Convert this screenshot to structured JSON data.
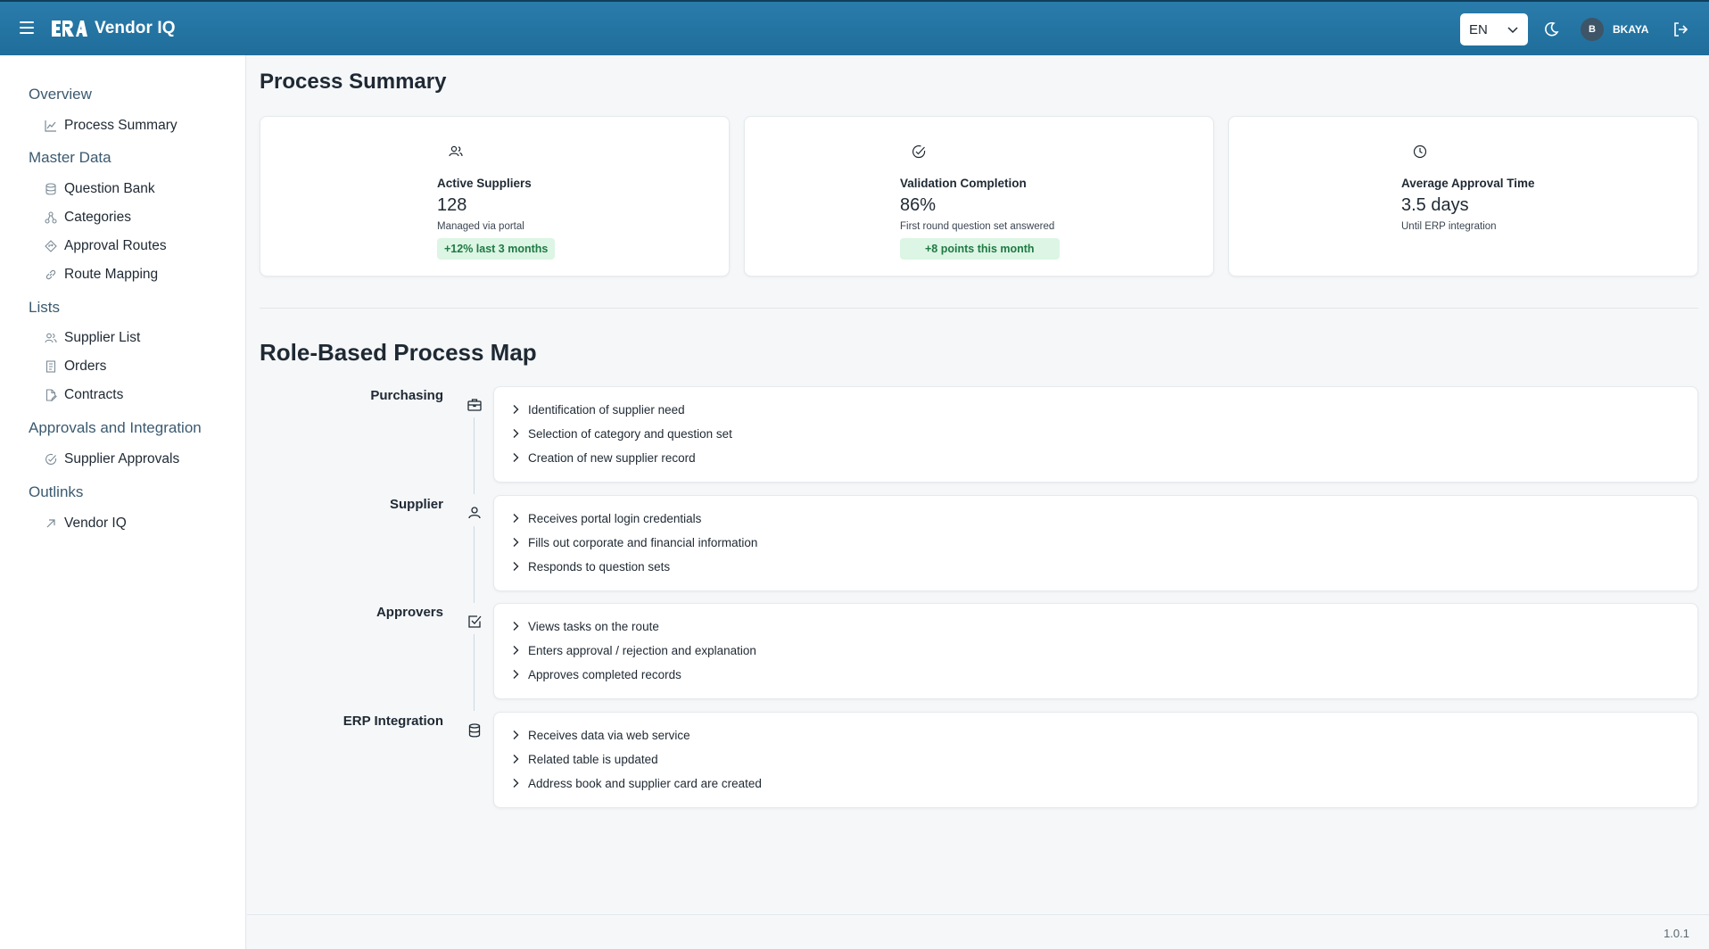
{
  "header": {
    "app_title": "Vendor IQ",
    "language": "EN",
    "user_initial": "B",
    "username": "BKAYA"
  },
  "sidebar": {
    "sections": [
      {
        "title": "Overview",
        "items": [
          {
            "label": "Process Summary",
            "icon": "chart-line-icon"
          }
        ]
      },
      {
        "title": "Master Data",
        "items": [
          {
            "label": "Question Bank",
            "icon": "database-icon"
          },
          {
            "label": "Categories",
            "icon": "hierarchy-icon"
          },
          {
            "label": "Approval Routes",
            "icon": "route-diamond-icon"
          },
          {
            "label": "Route Mapping",
            "icon": "link-icon"
          }
        ]
      },
      {
        "title": "Lists",
        "items": [
          {
            "label": "Supplier List",
            "icon": "users-icon"
          },
          {
            "label": "Orders",
            "icon": "receipt-icon"
          },
          {
            "label": "Contracts",
            "icon": "document-edit-icon"
          }
        ]
      },
      {
        "title": "Approvals and Integration",
        "items": [
          {
            "label": "Supplier Approvals",
            "icon": "check-circle-icon"
          }
        ]
      },
      {
        "title": "Outlinks",
        "items": [
          {
            "label": "Vendor IQ",
            "icon": "arrow-up-right-icon"
          }
        ]
      }
    ]
  },
  "main": {
    "page_title": "Process Summary",
    "stats": [
      {
        "icon": "users-icon",
        "label": "Active Suppliers",
        "value": "128",
        "sub": "Managed via portal",
        "badge": "+12% last 3 months"
      },
      {
        "icon": "check-circle-icon",
        "label": "Validation Completion",
        "value": "86%",
        "sub": "First round question set answered",
        "badge": "+8 points this month"
      },
      {
        "icon": "clock-icon",
        "label": "Average Approval Time",
        "value": "3.5 days",
        "sub": "Until ERP integration",
        "badge": ""
      }
    ],
    "process_map_title": "Role-Based Process Map",
    "roles": [
      {
        "name": "Purchasing",
        "icon": "briefcase-icon",
        "steps": [
          "Identification of supplier need",
          "Selection of category and question set",
          "Creation of new supplier record"
        ]
      },
      {
        "name": "Supplier",
        "icon": "user-icon",
        "steps": [
          "Receives portal login credentials",
          "Fills out corporate and financial information",
          "Responds to question sets"
        ]
      },
      {
        "name": "Approvers",
        "icon": "checkbox-icon",
        "steps": [
          "Views tasks on the route",
          "Enters approval / rejection and explanation",
          "Approves completed records"
        ]
      },
      {
        "name": "ERP Integration",
        "icon": "database-icon",
        "steps": [
          "Receives data via web service",
          "Related table is updated",
          "Address book and supplier card are created"
        ]
      }
    ]
  },
  "footer": {
    "version": "1.0.1"
  },
  "colors": {
    "header": "#1f6d9b",
    "badge_bg": "#dcf5e4",
    "badge_text": "#1f7a44"
  }
}
